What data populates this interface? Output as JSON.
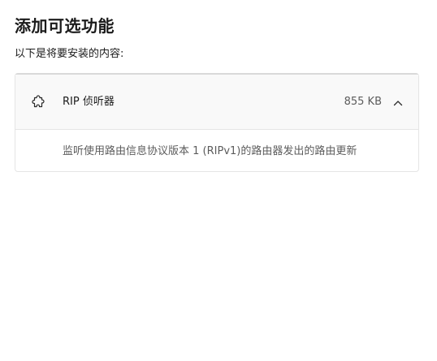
{
  "header": {
    "title": "添加可选功能",
    "subtitle": "以下是将要安装的内容:"
  },
  "feature": {
    "icon": "puzzle-piece-icon",
    "name": "RIP 侦听器",
    "size": "855 KB",
    "expand_icon": "chevron-up-icon",
    "description": "监听使用路由信息协议版本 1 (RIPv1)的路由器发出的路由更新"
  }
}
